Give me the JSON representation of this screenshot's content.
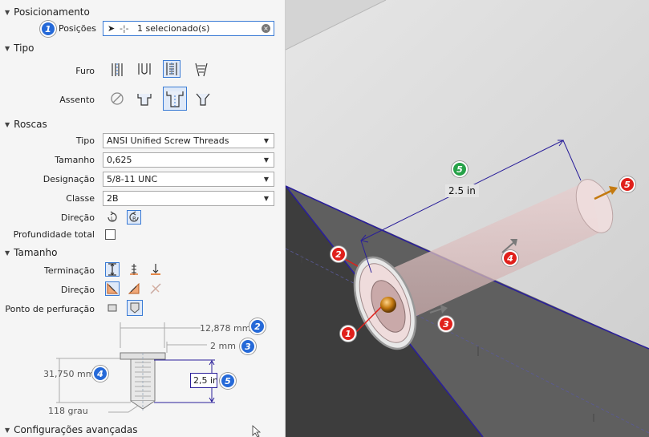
{
  "sections": {
    "positioning": "Posicionamento",
    "type": "Tipo",
    "threads": "Roscas",
    "size": "Tamanho",
    "advanced": "Configurações avançadas"
  },
  "positioning": {
    "label": "Posições",
    "value": "1 selecionado(s)"
  },
  "type": {
    "hole_label": "Furo",
    "seat_label": "Assento"
  },
  "threads": {
    "type_label": "Tipo",
    "type_value": "ANSI Unified Screw Threads",
    "size_label": "Tamanho",
    "size_value": "0,625",
    "designation_label": "Designação",
    "designation_value": "5/8-11 UNC",
    "class_label": "Classe",
    "class_value": "2B",
    "direction_label": "Direção",
    "full_depth_label": "Profundidade total"
  },
  "size": {
    "termination_label": "Terminação",
    "direction_label": "Direção",
    "drill_point_label": "Ponto de perfuração"
  },
  "diagram": {
    "dim_counterbore_dia": "12,878 mm",
    "dim_counterbore_depth": "2 mm",
    "dim_hole_dia": "31,750 mm",
    "dim_depth": "2,5 in",
    "dim_angle": "118 grau"
  },
  "badges": {
    "b1": "1",
    "b2": "2",
    "b3": "3",
    "b4": "4",
    "b5": "5"
  },
  "viewport": {
    "depth_label": "2.5 in"
  },
  "colors": {
    "accent": "#3a7bd5",
    "badge_blue": "#2569d8",
    "badge_red": "#e0201b",
    "badge_green": "#26a248",
    "edge_blue": "#2a1f9a"
  }
}
